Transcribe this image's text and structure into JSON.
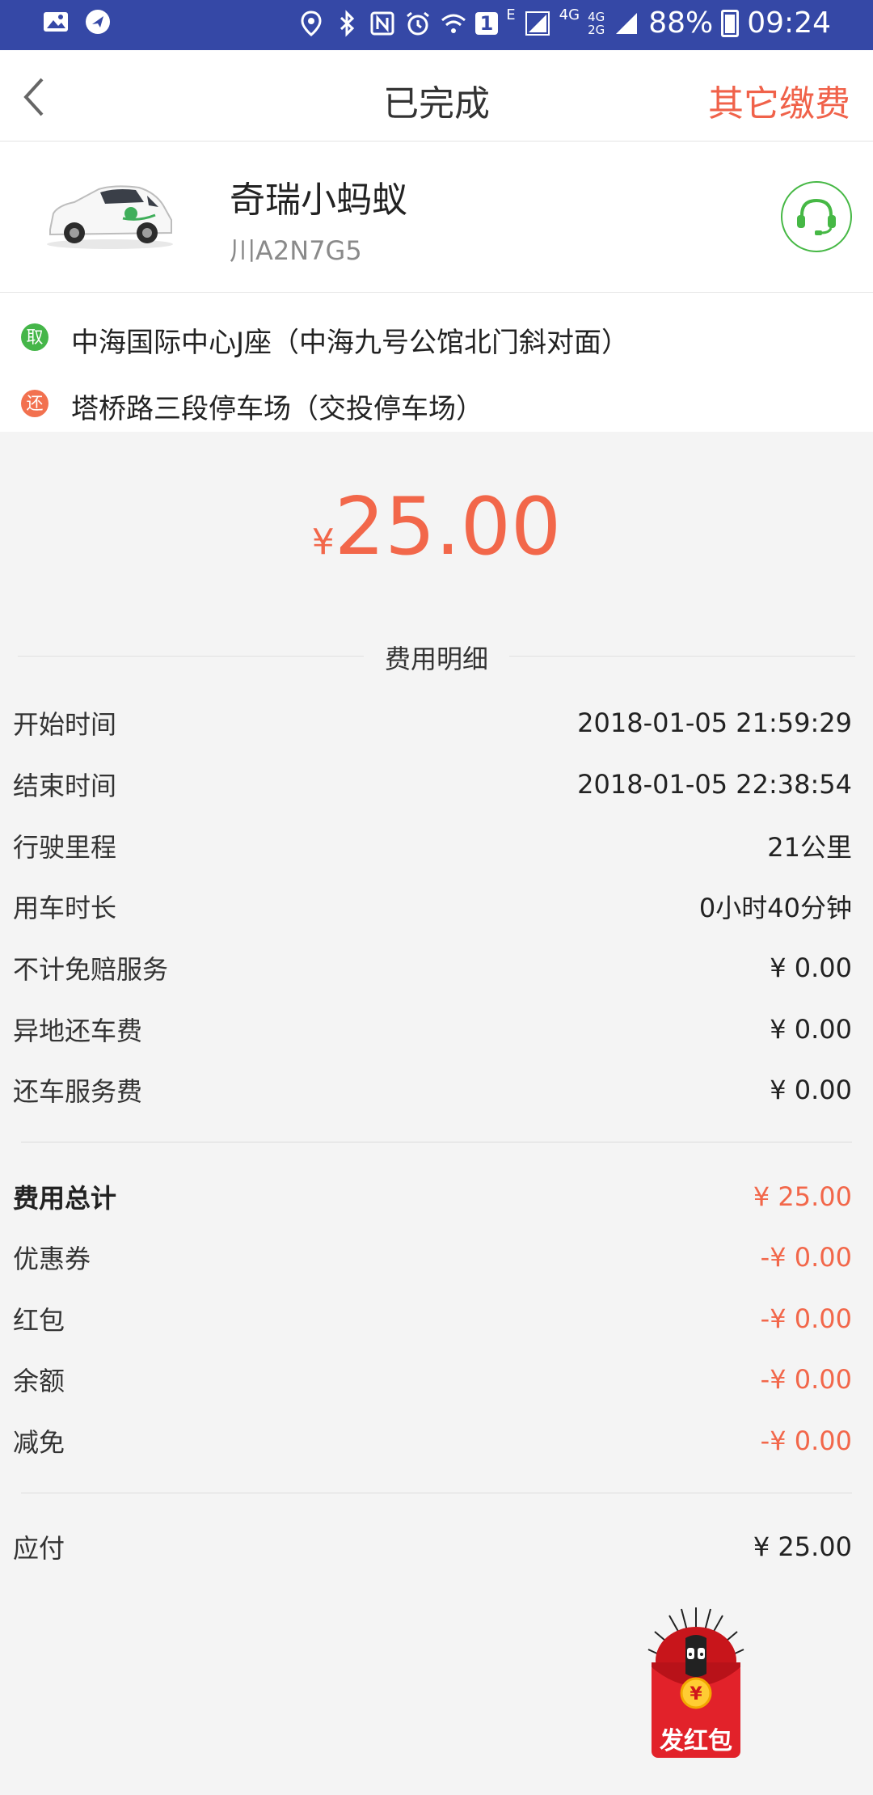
{
  "status_bar": {
    "battery": "88%",
    "time": "09:24",
    "network_1": "4G",
    "network_2": "4G",
    "network_2_sub": "2G",
    "notification_badge": "1",
    "e_indicator": "E"
  },
  "nav": {
    "title": "已完成",
    "other_fees": "其它缴费"
  },
  "car": {
    "name": "奇瑞小蚂蚁",
    "plate": "川A2N7G5"
  },
  "locations": {
    "pickup_badge": "取",
    "pickup": "中海国际中心J座（中海九号公馆北门斜对面）",
    "return_badge": "还",
    "return": "塔桥路三段停车场（交投停车场）"
  },
  "total": {
    "currency": "¥",
    "amount": "25.00"
  },
  "fee_section_title": "费用明细",
  "details": [
    {
      "label": "开始时间",
      "value": "2018-01-05 21:59:29"
    },
    {
      "label": "结束时间",
      "value": "2018-01-05 22:38:54"
    },
    {
      "label": "行驶里程",
      "value": "21公里"
    },
    {
      "label": "用车时长",
      "value": "0小时40分钟"
    },
    {
      "label": "不计免赔服务",
      "value": "¥ 0.00"
    },
    {
      "label": "异地还车费",
      "value": "¥ 0.00"
    },
    {
      "label": "还车服务费",
      "value": "¥ 0.00"
    }
  ],
  "summary": [
    {
      "label": "费用总计",
      "value": "¥ 25.00"
    },
    {
      "label": "优惠券",
      "value": "-¥ 0.00"
    },
    {
      "label": "红包",
      "value": "-¥ 0.00"
    },
    {
      "label": "余额",
      "value": "-¥ 0.00"
    },
    {
      "label": "减免",
      "value": "-¥ 0.00"
    }
  ],
  "payable": {
    "label": "应付",
    "value": "¥ 25.00"
  },
  "red_packet": {
    "label": "发红包",
    "coin": "¥"
  },
  "colors": {
    "status_bar": "#3548a6",
    "accent_red": "#f2674a",
    "pickup_green": "#45b649",
    "return_orange": "#f2714f",
    "support_green": "#46b845"
  }
}
